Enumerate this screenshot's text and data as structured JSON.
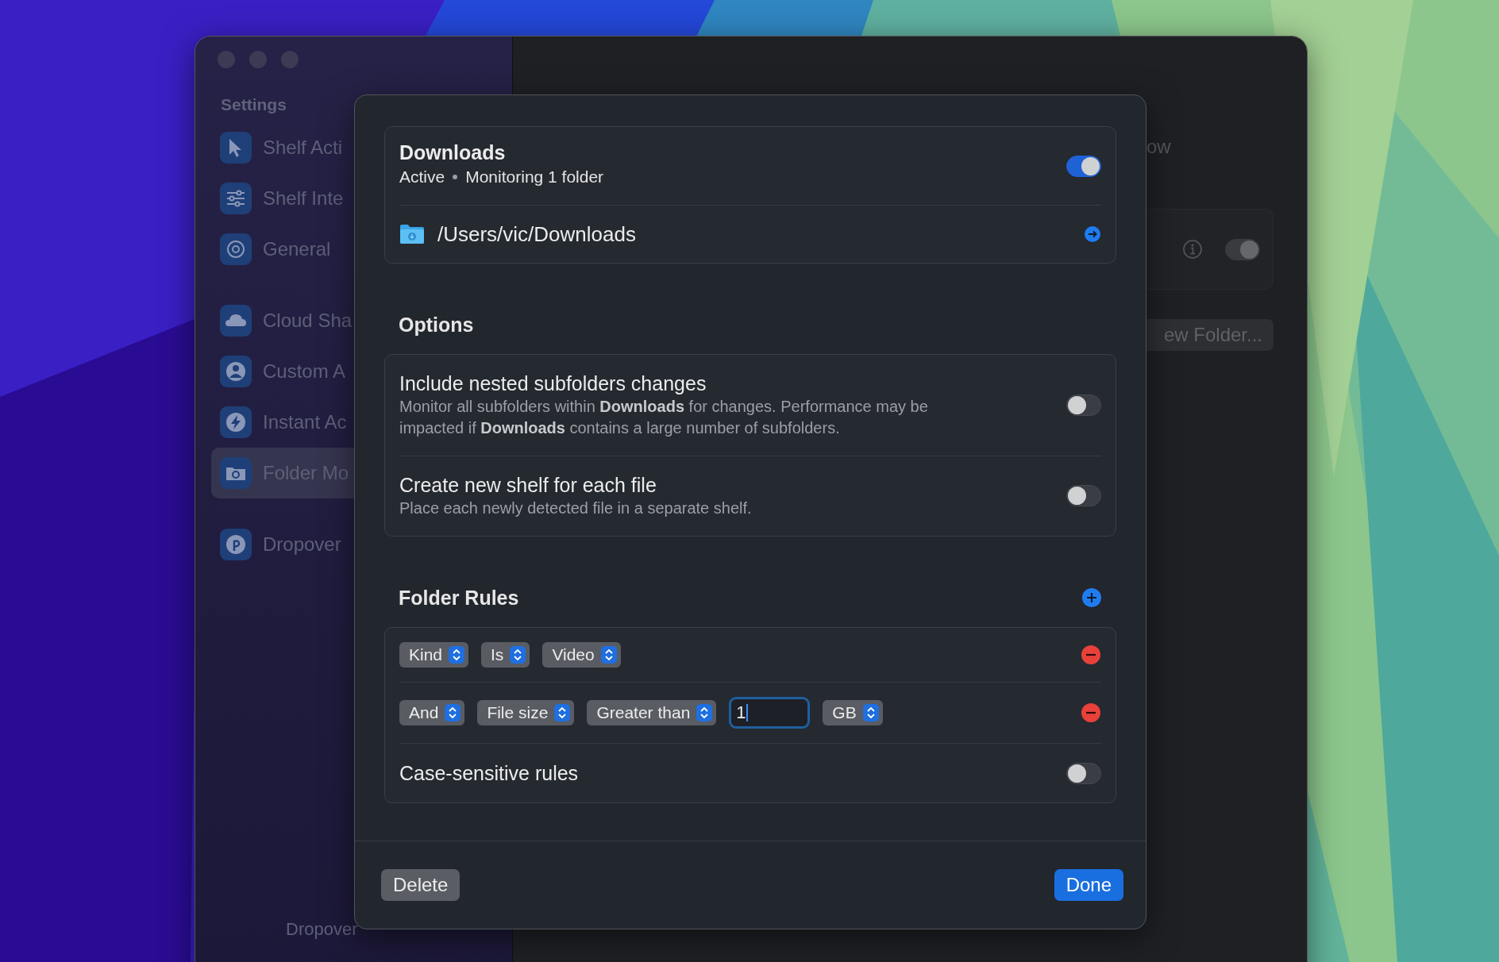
{
  "sidebar": {
    "heading": "Settings",
    "groups": [
      [
        {
          "label": "Shelf Acti",
          "selected": false
        },
        {
          "label": "Shelf Inte",
          "selected": false
        },
        {
          "label": "General",
          "selected": false
        }
      ],
      [
        {
          "label": "Cloud Sha",
          "selected": false
        },
        {
          "label": "Custom A",
          "selected": false
        },
        {
          "label": "Instant Ac",
          "selected": false
        },
        {
          "label": "Folder Mo",
          "selected": true
        }
      ],
      [
        {
          "label": "Dropover",
          "selected": false
        }
      ]
    ],
    "app_name": "Dropover"
  },
  "main": {
    "fragment": "ow",
    "card_toggle": {
      "on": true
    },
    "button": "ew Folder..."
  },
  "sheet": {
    "folder": {
      "title": "Downloads",
      "status": "Active",
      "detail": "Monitoring 1 folder",
      "enabled": true,
      "path": "/Users/vic/Downloads"
    },
    "options": {
      "heading": "Options",
      "items": [
        {
          "title": "Include nested subfolders changes",
          "description": "Monitor all subfolders within **Downloads** for changes. Performance may be impacted if **Downloads** contains a large number of subfolders.",
          "on": false
        },
        {
          "title": "Create new shelf for each file",
          "description": "Place each newly detected file in a separate shelf.",
          "on": false
        }
      ]
    },
    "rules": {
      "heading": "Folder Rules",
      "rows": [
        {
          "fields": [
            {
              "kind": "popup",
              "label": "Kind"
            },
            {
              "kind": "popup",
              "label": "Is"
            },
            {
              "kind": "popup",
              "label": "Video"
            }
          ]
        },
        {
          "fields": [
            {
              "kind": "popup",
              "label": "And"
            },
            {
              "kind": "popup",
              "label": "File size"
            },
            {
              "kind": "popup",
              "label": "Greater than"
            },
            {
              "kind": "input",
              "value": "1"
            },
            {
              "kind": "popup",
              "label": "GB"
            }
          ]
        }
      ],
      "case_sensitive": {
        "label": "Case-sensitive rules",
        "on": false
      }
    },
    "buttons": {
      "delete": "Delete",
      "done": "Done"
    }
  }
}
